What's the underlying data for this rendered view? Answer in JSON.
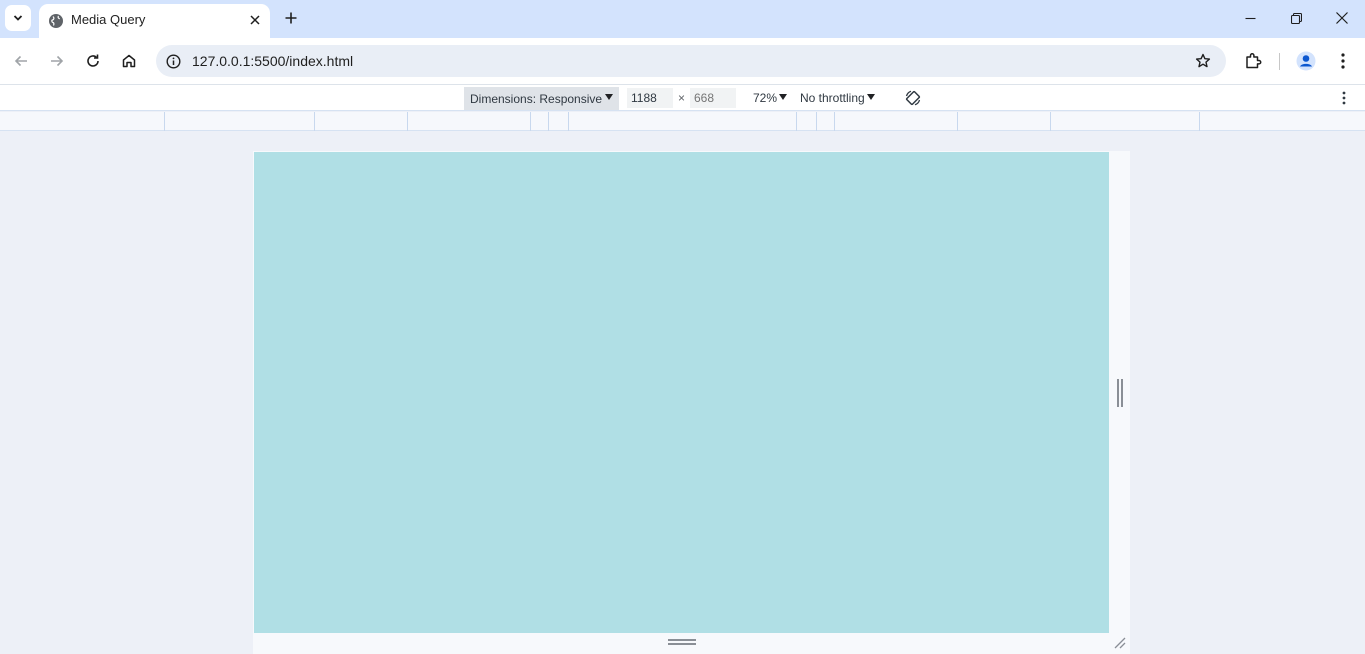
{
  "browser": {
    "tab": {
      "title": "Media Query",
      "favicon": "globe-icon"
    },
    "window_controls": [
      "minimize-icon",
      "restore-icon",
      "close-icon"
    ],
    "toolbar": {
      "url": "127.0.0.1:5500/index.html",
      "icons": [
        "back-icon",
        "forward-icon",
        "reload-icon",
        "home-icon",
        "site-info-icon",
        "bookmark-star-icon",
        "extensions-icon",
        "profile-avatar",
        "menu-icon"
      ]
    }
  },
  "device_toolbar": {
    "dimensions_label": "Dimensions: Responsive",
    "width": "1188",
    "height_placeholder": "668",
    "times": "×",
    "zoom": "72%",
    "throttling": "No throttling"
  },
  "viewport": {
    "background_color": "#b0dfe5"
  },
  "colors": {
    "tab_strip": "#d3e3fd",
    "omnibox": "#e9eef6",
    "page_bg": "#edf0f7"
  }
}
